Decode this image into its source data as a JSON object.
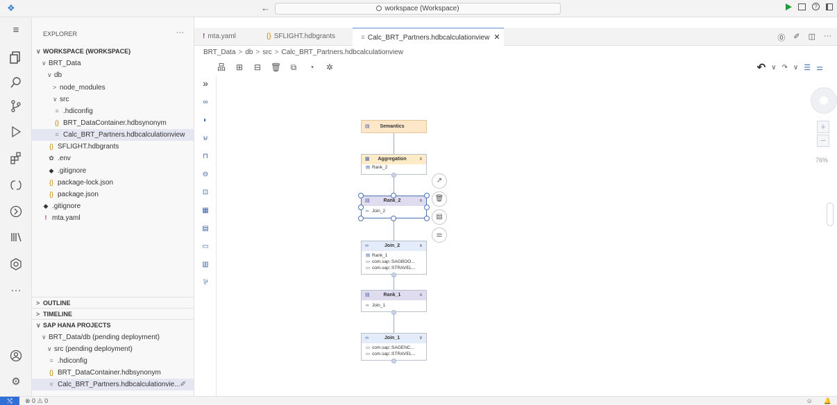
{
  "titlebar": {
    "search_text": "workspace (Workspace)",
    "nav_arrows": "← →"
  },
  "explorer": {
    "title": "EXPLORER",
    "more": "···",
    "workspace": "WORKSPACE (WORKSPACE)",
    "items": [
      {
        "label": "BRT_Data",
        "chev": "∨",
        "icon": ""
      },
      {
        "label": "db",
        "chev": "∨",
        "icon": ""
      },
      {
        "label": "node_modules",
        "chev": ">",
        "icon": ""
      },
      {
        "label": "src",
        "chev": "∨",
        "icon": ""
      },
      {
        "label": ".hdiconfig",
        "chev": "",
        "icon": "≡"
      },
      {
        "label": "BRT_DataContainer.hdbsynonym",
        "chev": "",
        "icon": "{}"
      },
      {
        "label": "Calc_BRT_Partners.hdbcalculationview",
        "chev": "",
        "icon": "≡"
      },
      {
        "label": "SFLIGHT.hdbgrants",
        "chev": "",
        "icon": "{}"
      },
      {
        "label": ".env",
        "chev": "",
        "icon": "✿"
      },
      {
        "label": ".gitignore",
        "chev": "",
        "icon": "◆"
      },
      {
        "label": "package-lock.json",
        "chev": "",
        "icon": "{}"
      },
      {
        "label": "package.json",
        "chev": "",
        "icon": "{}"
      },
      {
        "label": ".gitignore",
        "chev": "",
        "icon": "◆"
      },
      {
        "label": "mta.yaml",
        "chev": "",
        "icon": "!"
      }
    ],
    "outline": "OUTLINE",
    "timeline": "TIMELINE",
    "hana": "SAP HANA PROJECTS",
    "hana_items": [
      {
        "label": "BRT_Data/db (pending deployment)",
        "chev": "∨",
        "icon": ""
      },
      {
        "label": "src (pending deployment)",
        "chev": "∨",
        "icon": ""
      },
      {
        "label": ".hdiconfig",
        "chev": "",
        "icon": "≡"
      },
      {
        "label": "BRT_DataContainer.hdbsynonym",
        "chev": "",
        "icon": "{}"
      },
      {
        "label": "Calc_BRT_Partners.hdbcalculationvie...",
        "chev": "",
        "icon": "≡"
      }
    ]
  },
  "tabs": [
    {
      "label": "mta.yaml",
      "icon": "!"
    },
    {
      "label": "SFLIGHT.hdbgrants",
      "icon": "{}"
    },
    {
      "label": "Calc_BRT_Partners.hdbcalculationview",
      "icon": "≡",
      "close": "✕"
    }
  ],
  "breadcrumb": [
    "BRT_Data",
    "db",
    "src",
    "Calc_BRT_Partners.hdbcalculationview"
  ],
  "canvas": {
    "zoom": "76%",
    "nodes": {
      "semantics": {
        "title": "Semantics"
      },
      "aggregation": {
        "title": "Aggregation",
        "lines": [
          "Rank_2"
        ]
      },
      "rank2": {
        "title": "Rank_2",
        "lines": [
          "Join_2"
        ]
      },
      "join2": {
        "title": "Join_2",
        "lines": [
          "Rank_1",
          "com.sap::SAGBOO...",
          "com.sap::STRAVEL..."
        ]
      },
      "rank1": {
        "title": "Rank_1",
        "lines": [
          "Join_1"
        ]
      },
      "join1": {
        "title": "Join_1",
        "lines": [
          "com.sap::SAGENC...",
          "com.sap::STRAVEL..."
        ]
      }
    }
  },
  "statusbar": {
    "remote": "⤭",
    "problems": "⊗ 0 ⚠ 0"
  }
}
